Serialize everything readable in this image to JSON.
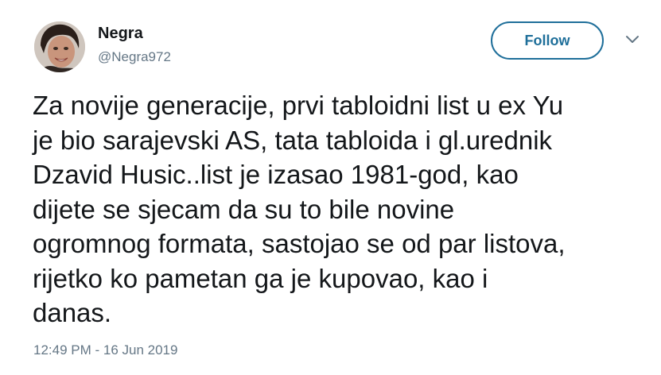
{
  "author": {
    "name": "Negra",
    "handle": "@Negra972"
  },
  "actions": {
    "follow_label": "Follow",
    "more_icon": "chevron-down-icon"
  },
  "tweet": {
    "lines": [
      "Za novije generacije, prvi tabloidni list u ex Yu",
      "je bio sarajevski AS, tata tabloida i gl.urednik",
      "Dzavid Husic..list je izasao 1981-god, kao",
      "dijete se sjecam da su to bile novine",
      "ogromnog formata, sastojao se od par listova,",
      "rijetko ko pametan ga je kupovao, kao i",
      "danas."
    ],
    "timestamp": "12:49 PM - 16 Jun 2019"
  },
  "colors": {
    "text": "#14171a",
    "secondary_text": "#657786",
    "follow_accent": "#1f6f9a"
  }
}
